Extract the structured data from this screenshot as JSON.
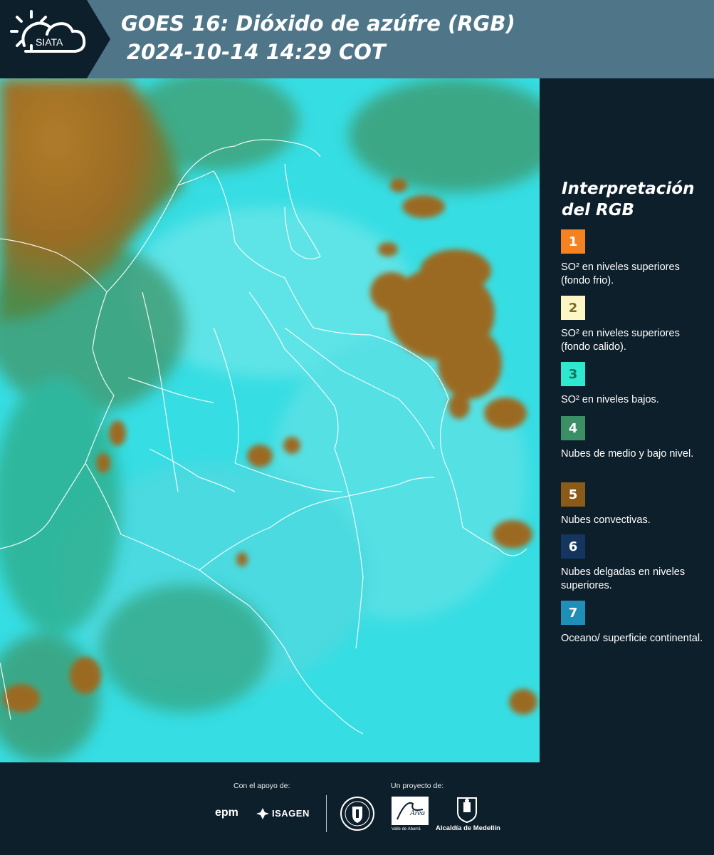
{
  "header": {
    "logo_text": "SIATA",
    "title_line1": "GOES 16: Dióxido de azúfre (RGB)",
    "title_line2": "2024-10-14 14:29 COT"
  },
  "legend": {
    "title": "Interpretación del RGB",
    "items": [
      {
        "number": "1",
        "color": "#f58220",
        "text_color": "#ffffff",
        "label": "SO² en niveles superiores (fondo frio)."
      },
      {
        "number": "2",
        "color": "#fdf7c6",
        "text_color": "#7a6a2a",
        "label": "SO² en niveles superiores (fondo calido)."
      },
      {
        "number": "3",
        "color": "#2ee8cf",
        "text_color": "#18705f",
        "label": "SO² en niveles bajos."
      },
      {
        "number": "4",
        "color": "#3a8f66",
        "text_color": "#ffffff",
        "label": "Nubes de medio y bajo nivel."
      },
      {
        "number": "5",
        "color": "#8a5a18",
        "text_color": "#ffffff",
        "label": "Nubes convectivas."
      },
      {
        "number": "6",
        "color": "#143560",
        "text_color": "#ffffff",
        "label": "Nubes delgadas en niveles superiores."
      },
      {
        "number": "7",
        "color": "#1f8fb8",
        "text_color": "#ffffff",
        "label": "Oceano/ superficie continental."
      }
    ]
  },
  "footer": {
    "support_label": "Con el apoyo de:",
    "project_label": "Un proyecto de:",
    "sponsors": [
      "epm",
      "ISAGEN"
    ],
    "partners": [
      "METROPOLITANA Valle de Aburrá",
      "Alcaldía de Medellín"
    ]
  },
  "colors": {
    "background": "#0d1f2b",
    "header_bar": "#4e7688",
    "ocean_land": "#34d8df",
    "convective": "#8a5a18",
    "mid_low_cloud": "#3a8f66"
  }
}
